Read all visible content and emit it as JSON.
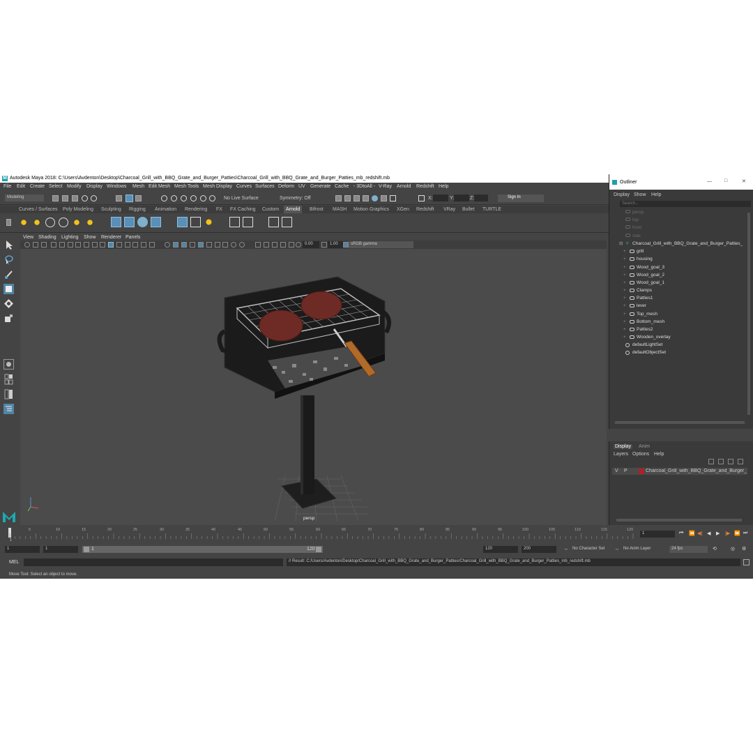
{
  "window": {
    "title": "Autodesk Maya 2018: C:\\Users\\Avdenton\\Desktop\\Charcoal_Grill_with_BBQ_Grate_and_Burger_Patties\\Charcoal_Grill_with_BBQ_Grate_and_Burger_Patties_mb_redshift.mb"
  },
  "menubar": [
    "File",
    "Edit",
    "Create",
    "Select",
    "Modify",
    "Display",
    "Windows",
    "Mesh",
    "Edit Mesh",
    "Mesh Tools",
    "Mesh Display",
    "Curves",
    "Surfaces",
    "Deform",
    "UV",
    "Generate",
    "Cache",
    "- 3DtoAll -",
    "V-Ray",
    "Arnold",
    "Redshift",
    "Help"
  ],
  "statusline": {
    "mode": "Modeling",
    "live_surface": "No Live Surface",
    "symmetry": "Symmetry: Off",
    "x_label": "X:",
    "y_label": "Y:",
    "z_label": "Z:",
    "sign_in": "Sign In"
  },
  "shelf_tabs": [
    "Curves / Surfaces",
    "Poly Modeling",
    "Sculpting",
    "Rigging",
    "Animation",
    "Rendering",
    "FX",
    "FX Caching",
    "Custom",
    "Arnold",
    "Bifrost",
    "MASH",
    "Motion Graphics",
    "XGen",
    "Redshift",
    "VRay",
    "Bullet",
    "TURTLE"
  ],
  "shelf_active": "Arnold",
  "viewport": {
    "menu": [
      "View",
      "Shading",
      "Lighting",
      "Show",
      "Renderer",
      "Panels"
    ],
    "exposure": "0.00",
    "gamma": "1.00",
    "color_space": "sRGB gamma",
    "camera_label": "persp"
  },
  "outliner": {
    "title": "Outliner",
    "menu": [
      "Display",
      "Show",
      "Help"
    ],
    "search_placeholder": "Search...",
    "cameras": [
      "persp",
      "top",
      "front",
      "side"
    ],
    "root": "Charcoal_Grill_with_BBQ_Grate_and_Burger_Patties_",
    "children": [
      "grill",
      "housing",
      "Wood_goal_3",
      "Wood_goal_2",
      "Wood_goal_1",
      "Clamps",
      "Patties1",
      "lever",
      "Top_mesh",
      "Bottom_mesh",
      "Patties2",
      "Wooden_overlay"
    ],
    "sets": [
      "defaultLightSet",
      "defaultObjectSet"
    ]
  },
  "layers": {
    "tabs": [
      "Display",
      "Anim"
    ],
    "menu": [
      "Layers",
      "Options",
      "Help"
    ],
    "layer_v": "V",
    "layer_p": "P",
    "layer_name": "Charcoal_Grill_with_BBQ_Grate_and_Burger_Patties",
    "layer_color": "#b0202a"
  },
  "timeline": {
    "ticks": [
      "5",
      "10",
      "15",
      "20",
      "25",
      "30",
      "35",
      "40",
      "45",
      "50",
      "55",
      "60",
      "65",
      "70",
      "75",
      "80",
      "85",
      "90",
      "95",
      "100",
      "105",
      "110",
      "115",
      "120"
    ],
    "first_tick": "1",
    "current_frame": "1"
  },
  "range": {
    "start": "1",
    "start2": "1",
    "slider_start": "1",
    "slider_end": "120",
    "end": "120",
    "end2": "200",
    "character_set": "No Character Set",
    "anim_layer": "No Anim Layer",
    "fps": "24 fps"
  },
  "cmdline": {
    "label": "MEL",
    "result": "// Result: C:/Users/Avdenton/Desktop/Charcoal_Grill_with_BBQ_Grate_and_Burger_Patties/Charcoal_Grill_with_BBQ_Grate_and_Burger_Patties_mb_redshift.mb"
  },
  "helpline": "Move Tool: Select an object to move.",
  "colors": {
    "accent": "#5285a6",
    "logo": "#1fa0a8",
    "grill": "#1e1e1e",
    "patty": "#6e2a24",
    "handle": "#b06a2a"
  }
}
